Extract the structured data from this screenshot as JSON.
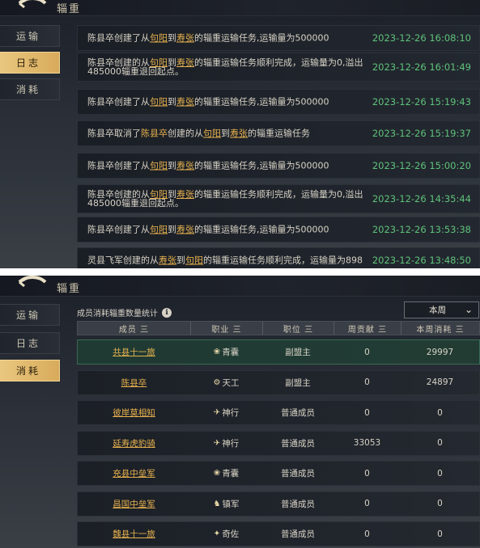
{
  "colors": {
    "accent_gold": "#e6b14e",
    "time_green": "#5fc27a",
    "active_tab": "#dfb66a"
  },
  "window": {
    "title": "辎重"
  },
  "tabs": [
    {
      "label": "运输"
    },
    {
      "label": "日志"
    },
    {
      "label": "消耗"
    }
  ],
  "log": {
    "rows": [
      {
        "pre": "陈县卒创建了从",
        "from": "句阳",
        "mid": "到",
        "to": "寿张",
        "post": "的辎重运输任务,运输量为500000",
        "time": "2023-12-26 16:08:10"
      },
      {
        "pre": "陈县卒创建的从",
        "from": "句阳",
        "mid": "到",
        "to": "寿张",
        "post": "的辎重运输任务顺利完成，运输量为0,溢出485000辎重退回起点。",
        "time": "2023-12-26 16:01:49"
      },
      {
        "pre": "陈县卒创建了从",
        "from": "句阳",
        "mid": "到",
        "to": "寿张",
        "post": "的辎重运输任务,运输量为500000",
        "time": "2023-12-26 15:19:43"
      },
      {
        "pre": "陈县卒取消了",
        "name": "陈县卒",
        "pre2": "创建的从",
        "from": "句阳",
        "mid": "到",
        "to": "寿张",
        "post": "的辎重运输任务",
        "time": "2023-12-26 15:19:37"
      },
      {
        "pre": "陈县卒创建了从",
        "from": "句阳",
        "mid": "到",
        "to": "寿张",
        "post": "的辎重运输任务,运输量为500000",
        "time": "2023-12-26 15:00:20"
      },
      {
        "pre": "陈县卒创建的从",
        "from": "句阳",
        "mid": "到",
        "to": "寿张",
        "post": "的辎重运输任务顺利完成，运输量为0,溢出485000辎重退回起点。",
        "time": "2023-12-26 14:35:44"
      },
      {
        "pre": "陈县卒创建了从",
        "from": "句阳",
        "mid": "到",
        "to": "寿张",
        "post": "的辎重运输任务,运输量为500000",
        "time": "2023-12-26 13:53:38"
      },
      {
        "pre": "灵县飞军创建的从",
        "from": "寿张",
        "mid": "到",
        "to": "句阳",
        "post": "的辎重运输任务顺利完成，运输量为898",
        "time": "2023-12-26 13:48:50"
      }
    ]
  },
  "consumption": {
    "title": "成员消耗辎重数量统计",
    "info_icon": "ℹ",
    "period_selected": "本周",
    "columns": [
      "成员 三",
      "职业 三",
      "职位 三",
      "周贡献 三",
      "本周消耗 三"
    ],
    "rows": [
      {
        "member": "共县十一旅",
        "job": "青囊",
        "job_icon": "❀",
        "position": "副盟主",
        "contrib": "0",
        "consumed": "29997"
      },
      {
        "member": "陈县卒",
        "job": "天工",
        "job_icon": "⚙",
        "position": "副盟主",
        "contrib": "0",
        "consumed": "24897"
      },
      {
        "member": "彼岸莫相知",
        "job": "神行",
        "job_icon": "✈",
        "position": "普通成员",
        "contrib": "0",
        "consumed": "0"
      },
      {
        "member": "延寿虎豹骑",
        "job": "神行",
        "job_icon": "✈",
        "position": "普通成员",
        "contrib": "33053",
        "consumed": "0"
      },
      {
        "member": "充县中垒军",
        "job": "青囊",
        "job_icon": "❀",
        "position": "普通成员",
        "contrib": "0",
        "consumed": "0"
      },
      {
        "member": "昌国中垒军",
        "job": "镇军",
        "job_icon": "♞",
        "position": "普通成员",
        "contrib": "0",
        "consumed": "0"
      },
      {
        "member": "魏县十一旅",
        "job": "奇佐",
        "job_icon": "✦",
        "position": "普通成员",
        "contrib": "0",
        "consumed": "0"
      }
    ]
  }
}
